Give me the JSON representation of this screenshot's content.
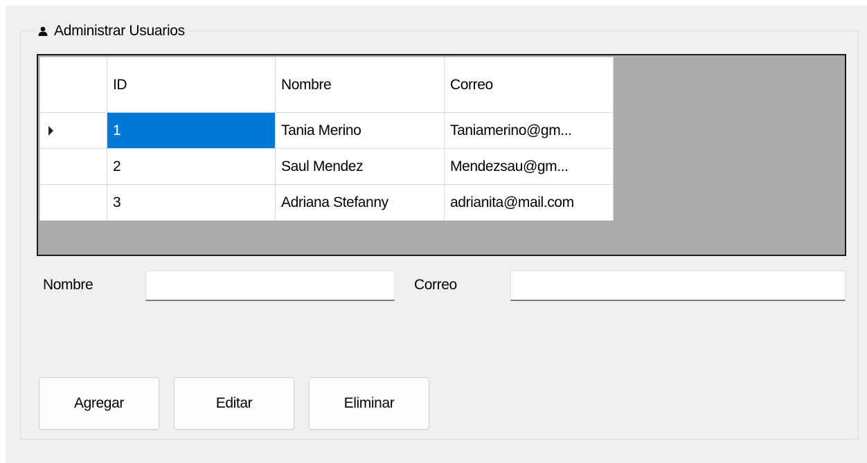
{
  "group": {
    "title": "Administrar Usuarios"
  },
  "table": {
    "columns": [
      "ID",
      "Nombre",
      "Correo"
    ],
    "rows": [
      {
        "id": "1",
        "nombre": "Tania Merino",
        "correo": "Taniamerino@gm..."
      },
      {
        "id": "2",
        "nombre": "Saul Mendez",
        "correo": "Mendezsau@gm..."
      },
      {
        "id": "3",
        "nombre": "Adriana Stefanny",
        "correo": "adrianita@mail.com"
      }
    ],
    "selected_row": 0
  },
  "form": {
    "nombre_label": "Nombre",
    "nombre_value": "",
    "correo_label": "Correo",
    "correo_value": ""
  },
  "buttons": {
    "agregar": "Agregar",
    "editar": "Editar",
    "eliminar": "Eliminar"
  },
  "colors": {
    "selection": "#0078d7",
    "grid_background": "#ababab",
    "window_background": "#f0f0f0"
  },
  "icons": {
    "group": "user-icon",
    "current_row": "current-row-arrow-icon"
  }
}
